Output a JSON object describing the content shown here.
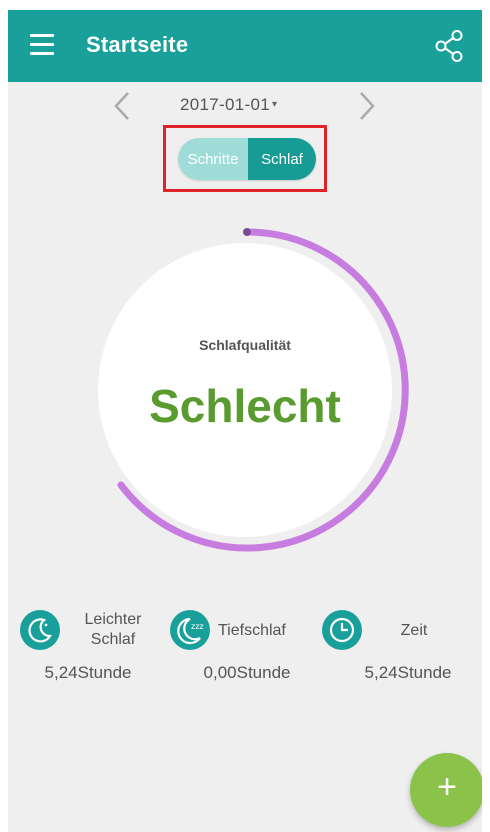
{
  "appbar": {
    "title": "Startseite",
    "menu_icon": "hamburger-menu-icon",
    "share_icon": "share-icon",
    "color": "#1aa09a"
  },
  "date_nav": {
    "date": "2017-01-01",
    "caret": "▾",
    "prev_icon": "chevron-left-icon",
    "next_icon": "chevron-right-icon"
  },
  "toggle": {
    "steps_label": "Schritte",
    "sleep_label": "Schlaf",
    "selected": "Schlaf"
  },
  "gauge": {
    "label": "Schlafqualität",
    "value": "Schlecht",
    "value_color": "#5a9b30",
    "arc_color": "#c77ddf"
  },
  "stats": [
    {
      "icon": "moon-star-icon",
      "label": "Leichter Schlaf",
      "value": "5,24Stunde"
    },
    {
      "icon": "moon-zzz-icon",
      "label": "Tiefschlaf",
      "value": "0,00Stunde"
    },
    {
      "icon": "clock-icon",
      "label": "Zeit",
      "value": "5,24Stunde"
    }
  ],
  "fab": {
    "icon": "plus-icon",
    "label": "+",
    "color": "#8bc34a"
  }
}
